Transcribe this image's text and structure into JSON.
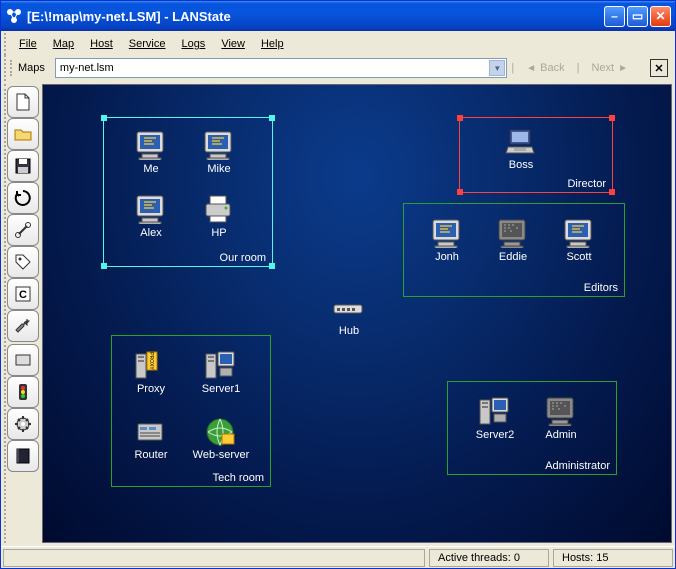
{
  "window": {
    "title": "[E:\\!map\\my-net.LSM] - LANState"
  },
  "menu": {
    "file": "File",
    "map": "Map",
    "host": "Host",
    "service": "Service",
    "logs": "Logs",
    "view": "View",
    "help": "Help"
  },
  "toolbar": {
    "maps_label": "Maps",
    "current_map": "my-net.lsm",
    "back": "Back",
    "next": "Next"
  },
  "groups": {
    "our_room": {
      "label": "Our room",
      "color": "#53f7e8"
    },
    "director": {
      "label": "Director",
      "color": "#ff4040"
    },
    "editors": {
      "label": "Editors",
      "color": "#2ca02c"
    },
    "tech_room": {
      "label": "Tech room",
      "color": "#2ca02c"
    },
    "administrator": {
      "label": "Administrator",
      "color": "#2ca02c"
    }
  },
  "nodes": {
    "me": "Me",
    "mike": "Mike",
    "alex": "Alex",
    "hp": "HP",
    "boss": "Boss",
    "jonh": "Jonh",
    "eddie": "Eddie",
    "scott": "Scott",
    "hub": "Hub",
    "proxy": "Proxy",
    "server1": "Server1",
    "router": "Router",
    "webserver": "Web-server",
    "server2": "Server2",
    "admin": "Admin"
  },
  "status": {
    "active_threads": "Active threads: 0",
    "hosts": "Hosts: 15"
  }
}
